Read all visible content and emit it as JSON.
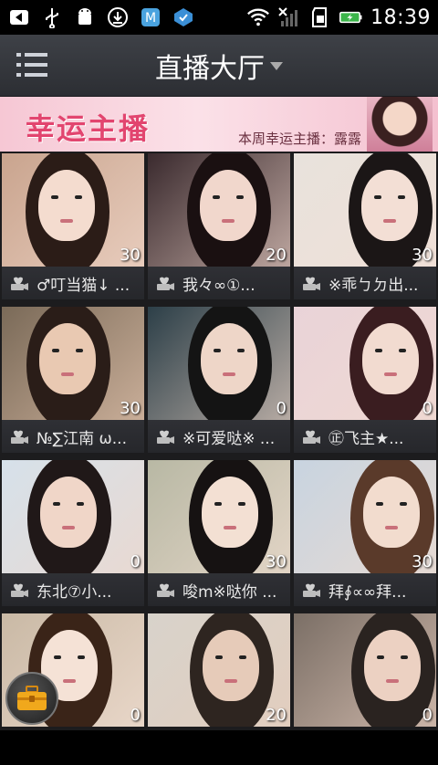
{
  "status_bar": {
    "time": "18:39",
    "icons": [
      "back-icon",
      "usb-icon",
      "android-debug-icon",
      "download-icon",
      "app-m-icon",
      "notification-icon",
      "wifi-icon",
      "no-signal-icon",
      "sd-card-icon",
      "battery-charging-icon"
    ]
  },
  "header": {
    "title": "直播大厅",
    "menu_icon": "list-menu-icon",
    "dropdown_icon": "caret-down-icon"
  },
  "banner": {
    "title": "幸运主播",
    "subtitle": "本周幸运主播：露露"
  },
  "streams": [
    {
      "name": "♂叮当猫↓ ...",
      "viewers": "30"
    },
    {
      "name": "我々∞①...",
      "viewers": "20"
    },
    {
      "name": "※乖ㄅㄉ出...",
      "viewers": "30"
    },
    {
      "name": "№∑江南 ω...",
      "viewers": "30"
    },
    {
      "name": "※可爱哒※ ...",
      "viewers": "0"
    },
    {
      "name": "㊣飞主★...",
      "viewers": "0"
    },
    {
      "name": "东北⑦小...",
      "viewers": "0"
    },
    {
      "name": "唆m※哒你 ...",
      "viewers": "30"
    },
    {
      "name": "拜∮∝∞拜...",
      "viewers": "30"
    },
    {
      "name": "",
      "viewers": "0"
    },
    {
      "name": "",
      "viewers": "20"
    },
    {
      "name": "",
      "viewers": "0"
    }
  ],
  "fab": {
    "icon": "toolbox-icon"
  },
  "colors": {
    "accent": "#e2456f",
    "titlebar": "#34363b",
    "caption_bg": "#2a2b2f"
  }
}
